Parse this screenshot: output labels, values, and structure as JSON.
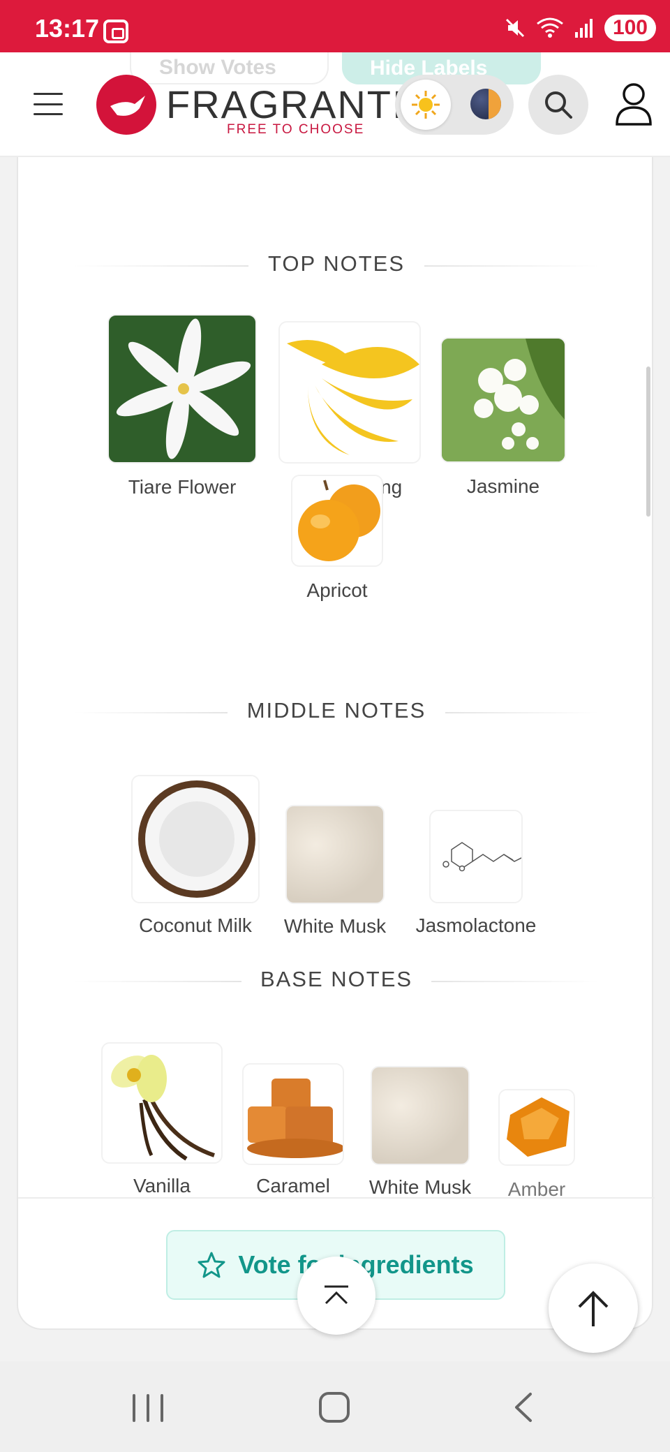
{
  "status_bar": {
    "time": "13:17",
    "battery": "100"
  },
  "header": {
    "brand": "FRAGRANTICA",
    "tagline": "FREE TO CHOOSE",
    "ghost_show_votes": "Show Votes",
    "ghost_hide_labels": "Hide Labels"
  },
  "sections": {
    "top": {
      "title": "TOP NOTES",
      "notes": [
        {
          "label": "Tiare Flower",
          "icon": "tiare-flower-image"
        },
        {
          "label": "Ylang Ylang",
          "icon": "ylang-ylang-image"
        },
        {
          "label": "Jasmine",
          "icon": "jasmine-image"
        },
        {
          "label": "Apricot",
          "icon": "apricot-image"
        }
      ]
    },
    "middle": {
      "title": "MIDDLE NOTES",
      "notes": [
        {
          "label": "Coconut Milk",
          "icon": "coconut-milk-image"
        },
        {
          "label": "White Musk",
          "icon": "white-musk-image"
        },
        {
          "label": "Jasmolactone",
          "icon": "jasmolactone-molecule-image"
        }
      ]
    },
    "base": {
      "title": "BASE NOTES",
      "notes": [
        {
          "label": "Vanilla",
          "icon": "vanilla-image"
        },
        {
          "label": "Caramel",
          "icon": "caramel-image"
        },
        {
          "label": "White Musk",
          "icon": "white-musk-image"
        },
        {
          "label": "Amber",
          "icon": "amber-image"
        }
      ]
    }
  },
  "vote_button": {
    "label": "Vote for ingredients"
  },
  "colors": {
    "brand": "#dd1a3c",
    "accent_teal": "#12968a"
  }
}
